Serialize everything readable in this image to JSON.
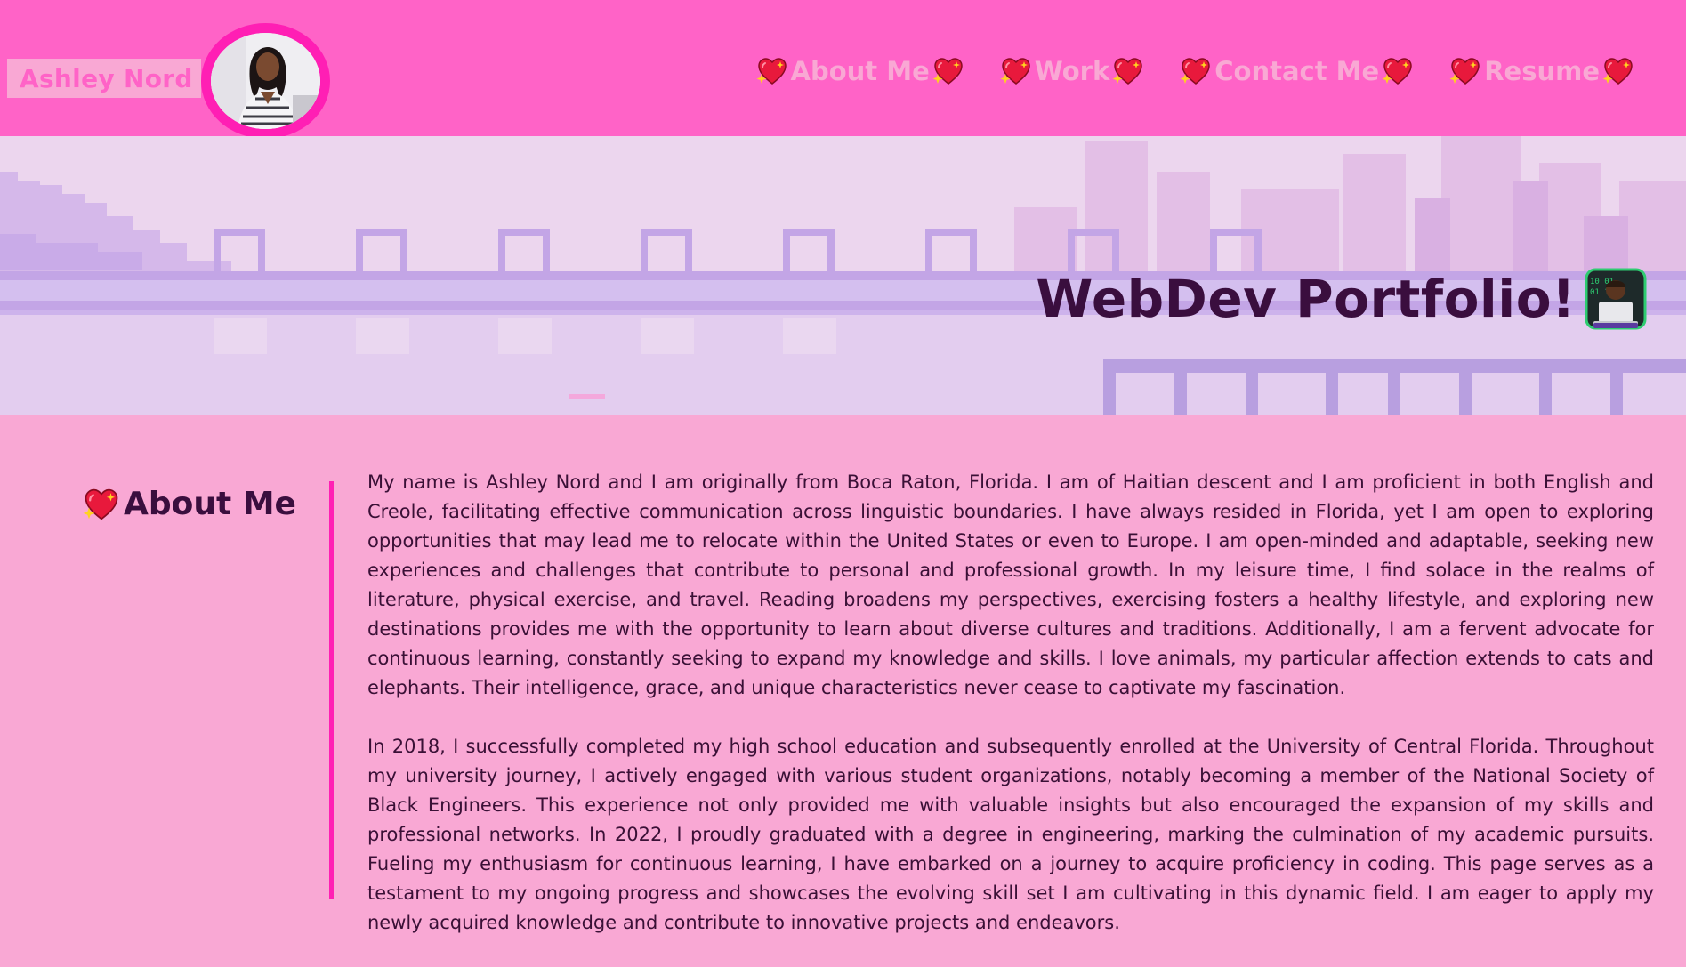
{
  "header": {
    "name": "Ashley Nord",
    "nav": [
      {
        "label": "About Me"
      },
      {
        "label": "Work"
      },
      {
        "label": "Contact Me"
      },
      {
        "label": "Resume"
      }
    ]
  },
  "hero": {
    "title": "WebDev Portfolio!"
  },
  "about": {
    "heading": "About Me",
    "paragraphs": [
      "My name is Ashley Nord and I am originally from Boca Raton, Florida. I am of Haitian descent and I am proficient in both English and Creole, facilitating effective communication across linguistic boundaries. I have always resided in Florida, yet I am open to exploring opportunities that may lead me to relocate within the United States or even to Europe. I am open-minded and adaptable, seeking new experiences and challenges that contribute to personal and professional growth. In my leisure time, I find solace in the realms of literature, physical exercise, and travel. Reading broadens my perspectives, exercising fosters a healthy lifestyle, and exploring new destinations provides me with the opportunity to learn about diverse cultures and traditions. Additionally, I am a fervent advocate for continuous learning, constantly seeking to expand my knowledge and skills. I love animals, my particular affection extends to cats and elephants. Their intelligence, grace, and unique characteristics never cease to captivate my fascination.",
      "In 2018, I successfully completed my high school education and subsequently enrolled at the University of Central Florida. Throughout my university journey, I actively engaged with various student organizations, notably becoming a member of the National Society of Black Engineers. This experience not only provided me with valuable insights but also encouraged the expansion of my skills and professional networks. In 2022, I proudly graduated with a degree in engineering, marking the culmination of my academic pursuits. Fueling my enthusiasm for continuous learning, I have embarked on a journey to acquire proficiency in coding. This page serves as a testament to my ongoing progress and showcases the evolving skill set I am cultivating in this dynamic field. I am eager to apply my newly acquired knowledge and contribute to innovative projects and endeavors."
    ]
  },
  "icons": {
    "nav_icon": "sparkling-heart-icon",
    "hero_icon": "technologist-laptop-icon",
    "profile": "profile-photo"
  },
  "colors": {
    "header_bg": "#ff63c7",
    "page_bg": "#f9a8d4",
    "accent": "#ff1fb4",
    "heading_text": "#3a0e3e"
  }
}
